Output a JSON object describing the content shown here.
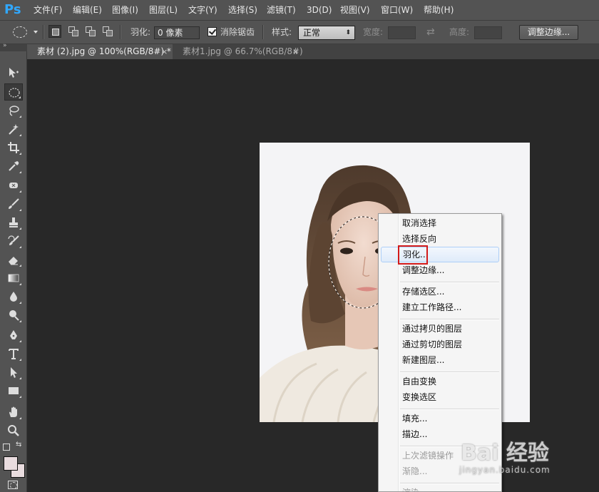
{
  "app": {
    "logo": "Ps"
  },
  "menu": [
    "文件(F)",
    "编辑(E)",
    "图像(I)",
    "图层(L)",
    "文字(Y)",
    "选择(S)",
    "滤镜(T)",
    "3D(D)",
    "视图(V)",
    "窗口(W)",
    "帮助(H)"
  ],
  "options": {
    "feather_label": "羽化:",
    "feather_value": "0 像素",
    "antialias_label": "消除锯齿",
    "antialias_checked": true,
    "style_label": "样式:",
    "style_value": "正常",
    "width_label": "宽度:",
    "height_label": "高度:",
    "refine_button": "调整边缘..."
  },
  "tabs": [
    {
      "label": "素材 (2).jpg @ 100%(RGB/8#) *",
      "active": true
    },
    {
      "label": "素材1.jpg @ 66.7%(RGB/8#)",
      "active": false
    }
  ],
  "toolbox": {
    "collapse": "»",
    "tools": [
      "move-tool",
      "elliptical-marquee-tool",
      "lasso-tool",
      "magic-wand-tool",
      "crop-tool",
      "eyedropper-tool",
      "healing-brush-tool",
      "brush-tool",
      "clone-stamp-tool",
      "history-brush-tool",
      "eraser-tool",
      "gradient-tool",
      "blur-tool",
      "dodge-tool",
      "pen-tool",
      "type-tool",
      "path-selection-tool",
      "rectangle-tool",
      "hand-tool",
      "zoom-tool"
    ],
    "foreground_color": "#e9dcdf",
    "background_color": "#e9dcdf"
  },
  "context_menu": {
    "items": [
      {
        "label": "取消选择"
      },
      {
        "label": "选择反向"
      },
      {
        "label": "羽化...",
        "highlighted": true
      },
      {
        "label": "调整边缘..."
      },
      {
        "label": "存储选区..."
      },
      {
        "label": "建立工作路径..."
      },
      {
        "label": "通过拷贝的图层"
      },
      {
        "label": "通过剪切的图层"
      },
      {
        "label": "新建图层..."
      },
      {
        "label": "自由变换"
      },
      {
        "label": "变换选区"
      },
      {
        "label": "填充..."
      },
      {
        "label": "描边..."
      },
      {
        "label": "上次滤镜操作",
        "disabled": true
      },
      {
        "label": "渐隐...",
        "disabled": true
      },
      {
        "label": "渲染",
        "disabled": true
      }
    ]
  },
  "colors": {
    "highlight_box": "#d31a1a",
    "accent": "#31a8ff"
  },
  "watermark": {
    "logo": "Bai 经验",
    "sub": "jingyan.baidu.com"
  }
}
